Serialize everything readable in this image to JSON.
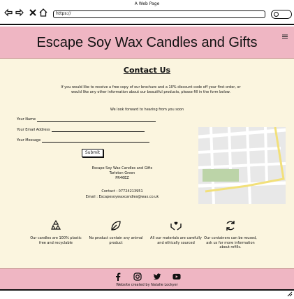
{
  "browser": {
    "window_title": "A Web Page",
    "url": "https://",
    "back_icon": "back-arrow-icon",
    "forward_icon": "forward-arrow-icon",
    "close_icon": "close-x-icon",
    "home_icon": "home-icon",
    "search_icon": "search-icon"
  },
  "header": {
    "title": "Escape Soy Wax Candles and Gifts",
    "menu_icon": "hamburger-menu-icon",
    "background": "#efb6c3"
  },
  "contact": {
    "heading": "Contact Us",
    "intro": "If you would like to receive a free copy of our brochure and a 10% discount code off your first order, or would like any other information about our beautiful products, please fill in the form below.",
    "forward": "We look forward to hearing from you soon",
    "form": {
      "name_label": "Your Name",
      "email_label": "Your Email Address",
      "message_label": "Your Message",
      "submit_label": "Submit"
    },
    "address": {
      "line1": "Escape Soy Wax Candles and Gifts",
      "line2": "Tarleton Green",
      "line3": "PR46EZ"
    },
    "contact_number": "Contact : 07724213951",
    "email": "Email : Escapesoywaxcandles@wax.co.uk",
    "background": "#fbf5df"
  },
  "features": [
    {
      "icon": "recycle-icon",
      "text": "Our candles are 100% plastic free and recyclable"
    },
    {
      "icon": "leaf-icon",
      "text": "No product contain any animal product"
    },
    {
      "icon": "hands-heart-icon",
      "text": "All our materials are carefully and ethically sourced"
    },
    {
      "icon": "refill-icon",
      "text": "Our containers can be reused, ask us for more information about refills."
    }
  ],
  "footer": {
    "socials": [
      "facebook-icon",
      "instagram-icon",
      "twitter-icon",
      "youtube-icon"
    ],
    "credit": "Website created by Natalie Lockyer"
  }
}
